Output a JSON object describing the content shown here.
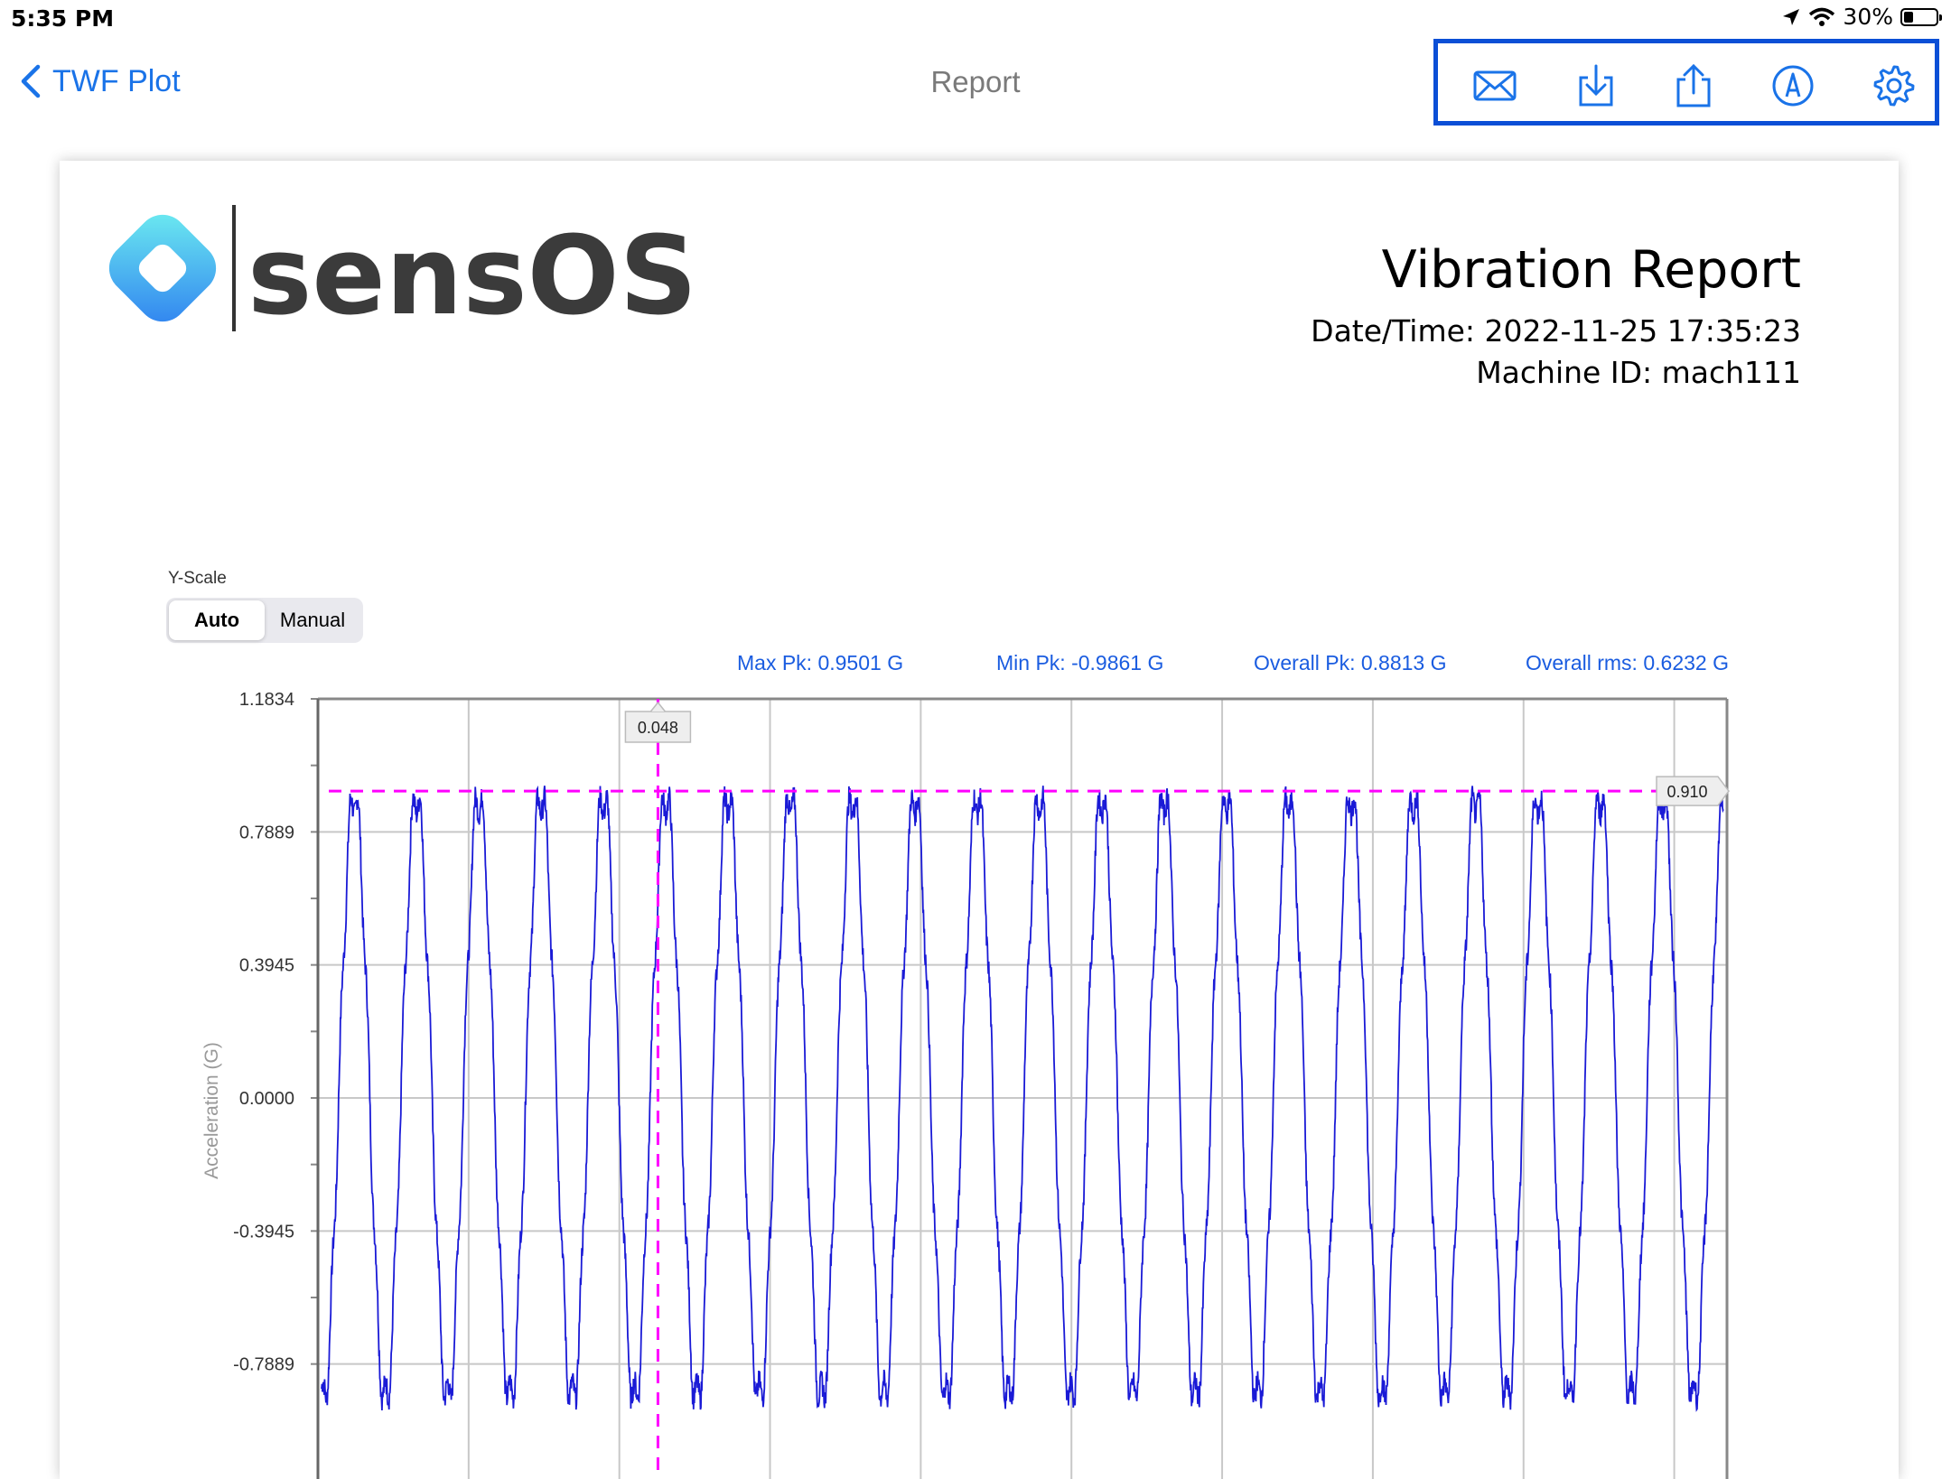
{
  "status_bar": {
    "time": "5:35 PM",
    "battery": "30%",
    "battery_level": 0.3
  },
  "nav": {
    "back_label": "TWF Plot",
    "title": "Report",
    "toolbar_icons": [
      "mail-icon",
      "download-icon",
      "share-icon",
      "markup-icon",
      "gear-icon"
    ]
  },
  "report": {
    "brand": "sensOS",
    "title": "Vibration Report",
    "datetime": "Date/Time: 2022-11-25 17:35:23",
    "machine_id": "Machine ID: mach111",
    "yscale_label": "Y-Scale",
    "yscale_options": [
      "Auto",
      "Manual"
    ],
    "yscale_selected": "Auto",
    "stats": {
      "max_pk": "Max Pk: 0.9501 G",
      "min_pk": "Min Pk: -0.9861 G",
      "overall_pk": "Overall Pk: 0.8813 G",
      "overall_rms": "Overall rms: 0.6232 G"
    }
  },
  "colors": {
    "accent": "#1a73e8",
    "toolbar_border": "#0b4fd6",
    "trace": "#1a1ad6",
    "cursor": "#ff00ff"
  },
  "chart_data": {
    "type": "line",
    "ylabel": "Acceleration (G)",
    "yticks": [
      "1.1834",
      "0.7889",
      "0.3945",
      "0.0000",
      "-0.3945",
      "-0.7889"
    ],
    "ylim": [
      -1.1834,
      1.1834
    ],
    "grid": true,
    "cycles_visible": 22.5,
    "amplitude": 0.9,
    "cursor_x_label": "0.048",
    "cursor_y_label": "0.910",
    "cursor_y_value": 0.91
  }
}
